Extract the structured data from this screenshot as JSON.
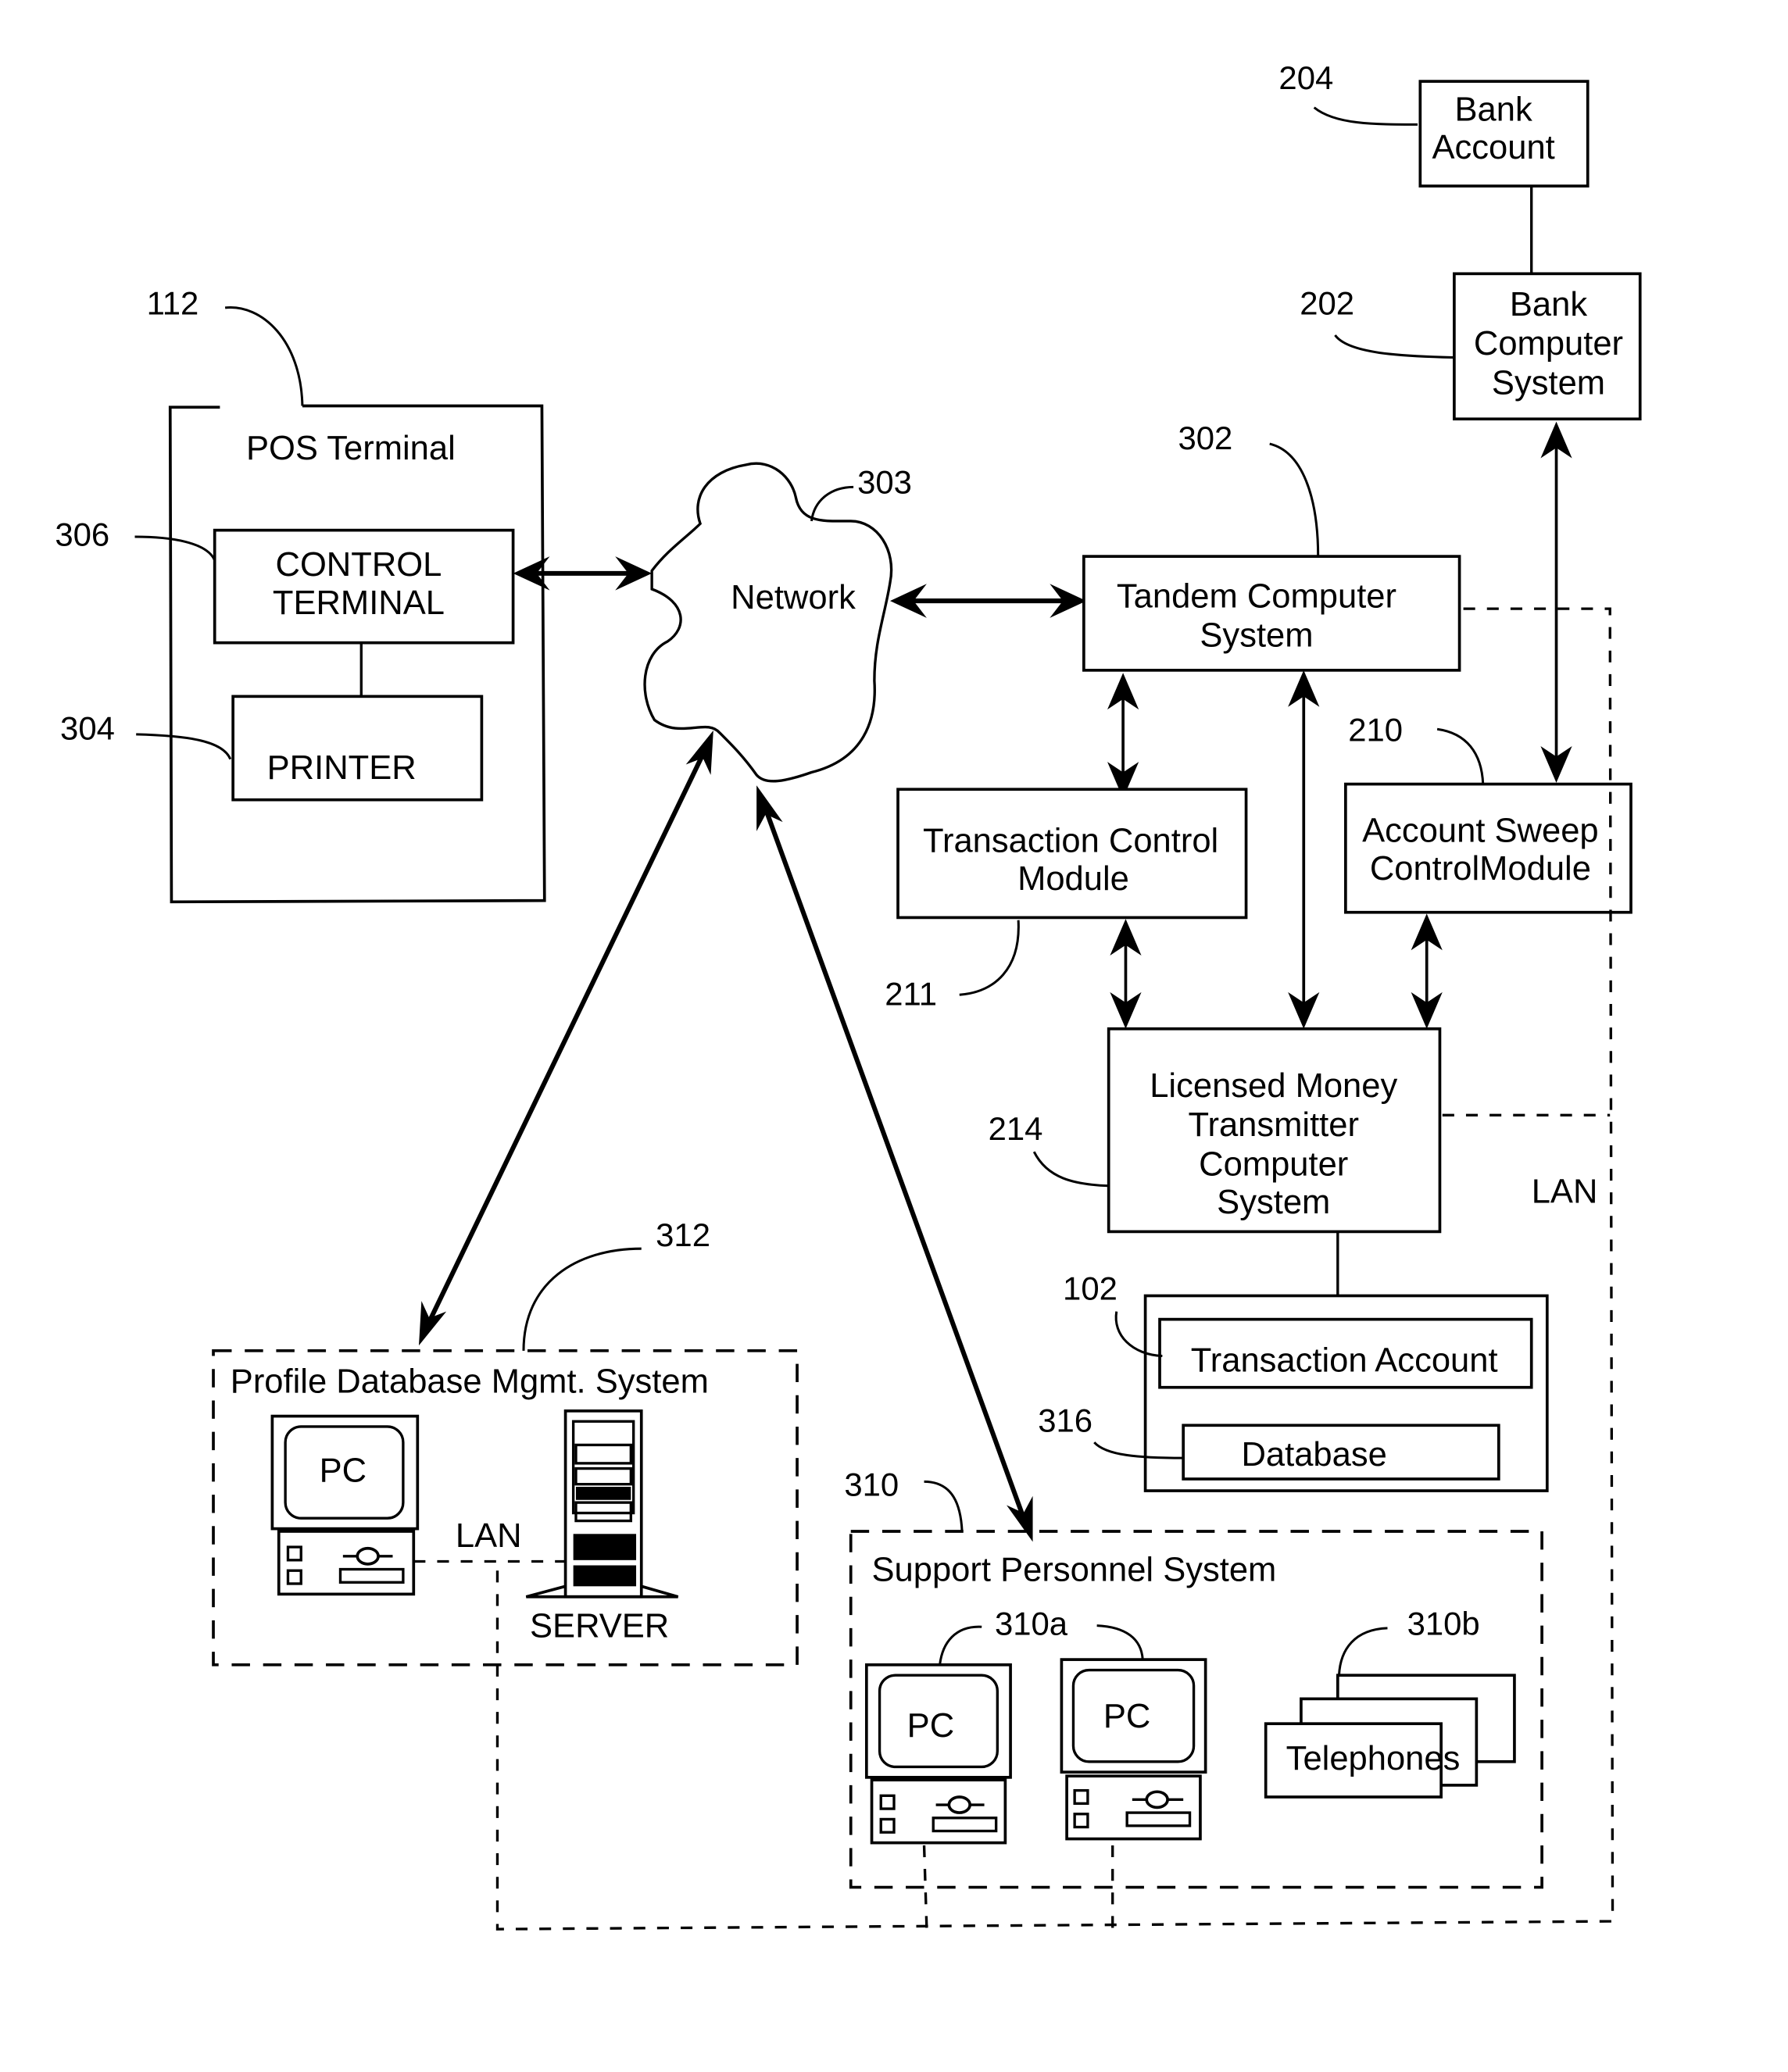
{
  "diagram": {
    "nodes": {
      "bank_account": {
        "ref": "204",
        "lines": [
          "Bank",
          "Account"
        ]
      },
      "bank_computer": {
        "ref": "202",
        "lines": [
          "Bank",
          "Computer",
          "System"
        ]
      },
      "pos_terminal": {
        "ref": "112",
        "title": "POS Terminal"
      },
      "control_terminal": {
        "ref": "306",
        "lines": [
          "CONTROL",
          "TERMINAL"
        ]
      },
      "printer": {
        "ref": "304",
        "label": "PRINTER"
      },
      "network": {
        "ref": "303",
        "label": "Network"
      },
      "tandem": {
        "ref": "302",
        "lines": [
          "Tandem Computer",
          "System"
        ]
      },
      "transaction_control": {
        "ref": "211",
        "lines": [
          "Transaction Control",
          "Module"
        ]
      },
      "account_sweep": {
        "ref": "210",
        "lines": [
          "Account Sweep",
          "ControlModule"
        ]
      },
      "licensed_money": {
        "ref": "214",
        "lines": [
          "Licensed Money",
          "Transmitter",
          "Computer",
          "System"
        ]
      },
      "transaction_account": {
        "ref": "102",
        "label": "Transaction Account"
      },
      "database": {
        "ref": "316",
        "label": "Database"
      },
      "profile_db": {
        "ref": "312",
        "title": "Profile Database Mgmt. System",
        "pc_label": "PC",
        "server_label": "SERVER",
        "lan_label": "LAN"
      },
      "support": {
        "ref": "310",
        "title": "Support Personnel System",
        "pc_ref": "310a",
        "phones_ref": "310b",
        "pc_label": "PC",
        "phones_label": "Telephones"
      },
      "lan_right": {
        "label": "LAN"
      }
    },
    "connections": [
      {
        "from": "Bank Account",
        "to": "Bank Computer System",
        "type": "line"
      },
      {
        "from": "Bank Computer System",
        "to": "Account Sweep ControlModule",
        "type": "bidirectional"
      },
      {
        "from": "CONTROL TERMINAL",
        "to": "PRINTER",
        "type": "line"
      },
      {
        "from": "CONTROL TERMINAL",
        "to": "Network",
        "type": "bidirectional"
      },
      {
        "from": "Network",
        "to": "Tandem Computer System",
        "type": "bidirectional"
      },
      {
        "from": "Network",
        "to": "Profile Database Mgmt. System",
        "type": "bidirectional"
      },
      {
        "from": "Network",
        "to": "Support Personnel System",
        "type": "bidirectional"
      },
      {
        "from": "Tandem Computer System",
        "to": "Transaction Control Module",
        "type": "bidirectional"
      },
      {
        "from": "Tandem Computer System",
        "to": "Licensed Money Transmitter Computer System",
        "type": "bidirectional"
      },
      {
        "from": "Transaction Control Module",
        "to": "Licensed Money Transmitter Computer System",
        "type": "bidirectional"
      },
      {
        "from": "Account Sweep ControlModule",
        "to": "Licensed Money Transmitter Computer System",
        "type": "bidirectional"
      },
      {
        "from": "Licensed Money Transmitter Computer System",
        "to": "Transaction Account / Database",
        "type": "line"
      },
      {
        "from": "Tandem Computer System",
        "to": "LAN",
        "type": "dashed"
      },
      {
        "from": "Licensed Money Transmitter Computer System",
        "to": "LAN",
        "type": "dashed"
      }
    ]
  }
}
